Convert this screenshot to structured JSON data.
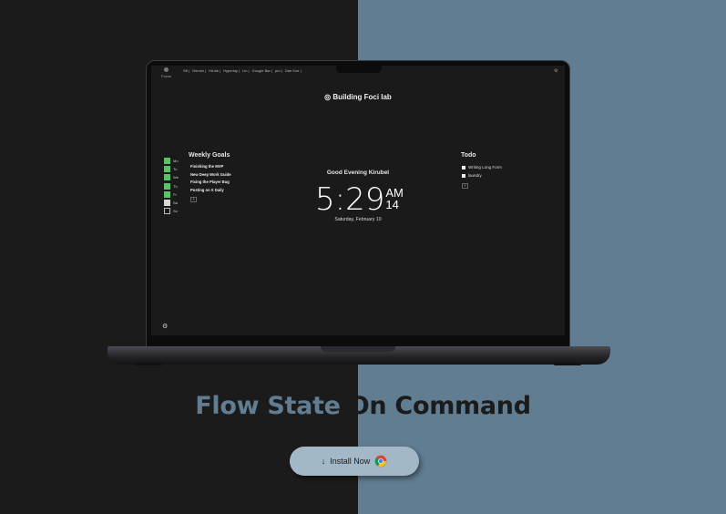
{
  "app": {
    "focus_label": "Focus",
    "brand": "Building Foci lab"
  },
  "bookmarks": [
    "S8 |",
    "Gemini |",
    "HiLink |",
    "Hyperlay |",
    "Lin |",
    "Google Bar |",
    "pro |",
    "Dan Koe |"
  ],
  "days": [
    {
      "label": "Mo",
      "state": "done"
    },
    {
      "label": "Tu",
      "state": "done"
    },
    {
      "label": "We",
      "state": "done"
    },
    {
      "label": "Th",
      "state": "done"
    },
    {
      "label": "Fr",
      "state": "done"
    },
    {
      "label": "Sa",
      "state": "partial"
    },
    {
      "label": "Su",
      "state": "empty"
    }
  ],
  "weekly_goals": {
    "title": "Weekly Goals",
    "items": [
      "Finishing the MVP",
      "New Deep Work Guide",
      "Fixing the Player Bug",
      "Posting on X Daily"
    ],
    "add_label": "+"
  },
  "clock": {
    "greeting": "Good Evening Kirubel",
    "time": "5:29",
    "ampm": "AM",
    "seconds": "14",
    "date": "Saturday, February 10"
  },
  "todo": {
    "title": "Todo",
    "items": [
      "Writing Long Form",
      "laundry"
    ],
    "add_label": "+"
  },
  "headline": {
    "part1": "Flow State ",
    "part2": "On Command"
  },
  "cta": {
    "arrow": "↓",
    "label": "Install Now"
  },
  "colors": {
    "left_bg": "#1b1b1b",
    "right_bg": "#607d92",
    "goal_done": "#5fbf6b",
    "button_bg": "#a3b8c7"
  },
  "icons": {
    "gear": "⚙",
    "brand_logo": "◎"
  }
}
